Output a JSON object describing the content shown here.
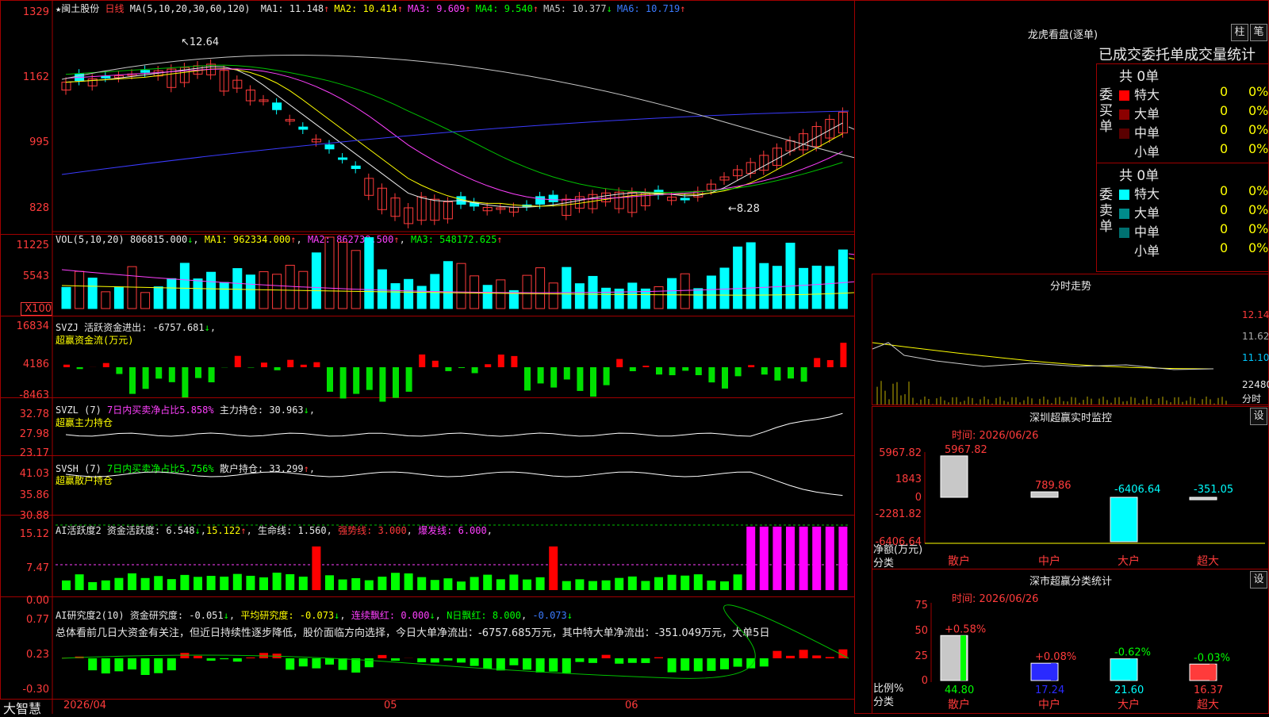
{
  "main_chart": {
    "stock_name": "闽土股份",
    "period": "日线",
    "ma_label": "MA(5,10,20,30,60,120)",
    "ma_values": [
      {
        "name": "MA1:",
        "value": "11.148",
        "arrow": "↑",
        "color": "#e8e8e8"
      },
      {
        "name": "MA2:",
        "value": "10.414",
        "arrow": "↑",
        "color": "#ffff00"
      },
      {
        "name": "MA3:",
        "value": "9.609",
        "arrow": "↑",
        "color": "#ff40ff"
      },
      {
        "name": "MA4:",
        "value": "9.540",
        "arrow": "↑",
        "color": "#00ff00"
      },
      {
        "name": "MA5:",
        "value": "10.377",
        "arrow": "↓",
        "color": "#c8c8c8"
      },
      {
        "name": "MA6:",
        "value": "10.719",
        "arrow": "↑",
        "color": "#3b7bff"
      }
    ],
    "y_ticks": [
      "1329",
      "1162",
      "995",
      "828"
    ],
    "high_label": "12.64",
    "low_label": "8.28"
  },
  "vol_panel": {
    "label": "VOL(5,10,20)",
    "value": "806815.000",
    "ma1": "962334.000",
    "ma2": "862738.500",
    "ma3": "548172.625",
    "y_ticks": [
      "11225",
      "5543",
      "X100"
    ]
  },
  "svzj_panel": {
    "label": "SVZJ  活跃资金进出:",
    "value": "-6757.681",
    "sub": "超赢资金流(万元)",
    "y_ticks": [
      "16834",
      "4186",
      "-8463"
    ]
  },
  "svzl_panel": {
    "label": "SVZL (7)",
    "desc": "7日内买卖净占比5.858%",
    "hold_label": "主力持仓:",
    "hold_value": "30.963",
    "sub": "超赢主力持仓",
    "y_ticks": [
      "32.78",
      "27.98",
      "23.17"
    ]
  },
  "svsh_panel": {
    "label": "SVSH (7)",
    "desc": "7日内买卖净占比5.756%",
    "hold_label": "散户持仓:",
    "hold_value": "33.299",
    "sub": "超赢散户持仓",
    "y_ticks": [
      "41.03",
      "35.86",
      "30.88"
    ]
  },
  "ai_active_panel": {
    "label": "AI活跃度2",
    "active_label": "资金活跃度:",
    "active_value": "6.548",
    "v2": "15.122",
    "life_label": "生命线:",
    "life_value": "1.560",
    "strong_label": "强势线:",
    "strong_value": "3.000",
    "burst_label": "爆发线:",
    "burst_value": "6.000",
    "y_ticks": [
      "15.12",
      "7.47",
      "0.00"
    ]
  },
  "ai_research_panel": {
    "label": "AI研究度2(10)",
    "r_label": "资金研究度:",
    "r_value": "-0.051",
    "avg_label": "平均研究度:",
    "avg_value": "-0.073",
    "cont_label": "连续飘红:",
    "cont_value": "0.000",
    "n_label": "N日飘红:",
    "n_value": "8.000",
    "n_extra": "-0.073",
    "commentary": "总体看前几日大资金有关注，但近日持续性逐步降低，股价面临方向选择，今日大单净流出：-6757.685万元，其中特大单净流出：-351.049万元，大单5日",
    "y_ticks": [
      "0.77",
      "0.23",
      "-0.30"
    ]
  },
  "bottom_axis": {
    "brand": "大智慧",
    "date1": "2026/04",
    "date2": "05",
    "date3": "06"
  },
  "right_panel": {
    "lhb_title": "龙虎看盘(逐单)",
    "btn_zhu": "柱",
    "btn_bi": "笔",
    "stats_title": "已成交委托单成交量统计",
    "buy_label": "委买单",
    "sell_label": "委卖单",
    "buy_total": "共 0单",
    "sell_total": "共 0单",
    "buy_rows": [
      {
        "name": "特大",
        "count": "0",
        "pct": "0%",
        "color": "#ff0000"
      },
      {
        "name": "大单",
        "count": "0",
        "pct": "0%",
        "color": "#8b0000"
      },
      {
        "name": "中单",
        "count": "0",
        "pct": "0%",
        "color": "#5a0000"
      },
      {
        "name": "小单",
        "count": "0",
        "pct": "0%",
        "color": "#000000"
      }
    ],
    "sell_rows": [
      {
        "name": "特大",
        "count": "0",
        "pct": "0%",
        "color": "#00ffff"
      },
      {
        "name": "大单",
        "count": "0",
        "pct": "0%",
        "color": "#008b8b"
      },
      {
        "name": "中单",
        "count": "0",
        "pct": "0%",
        "color": "#007070"
      },
      {
        "name": "小单",
        "count": "0",
        "pct": "0%",
        "color": "#000000"
      }
    ],
    "intraday_title": "分时走势",
    "intraday_ticks": [
      "12.14",
      "11.62",
      "11.10",
      "22480",
      "分时"
    ],
    "monitor_title": "深圳超赢实时监控",
    "monitor_btn": "设",
    "monitor_time": "时间: 2026/06/26",
    "monitor_ticks": [
      "5967.82",
      "1843",
      "0",
      "-2281.82",
      "-6406.64"
    ],
    "monitor_unit": "净额(万元)",
    "monitor_class": "分类",
    "classify_title": "深市超赢分类统计",
    "classify_btn": "设",
    "classify_time": "时间: 2026/06/26",
    "classify_ticks": [
      "75",
      "50",
      "25",
      "0"
    ],
    "classify_unit": "比例%",
    "classify_class": "分类"
  },
  "chart_data": [
    {
      "type": "bar",
      "title": "深圳超赢实时监控",
      "categories": [
        "散户",
        "中户",
        "大户",
        "超大"
      ],
      "values": [
        5967.82,
        789.86,
        -6406.64,
        -351.05
      ],
      "ylabel": "净额(万元)",
      "ylim": [
        -6406.64,
        5967.82
      ]
    },
    {
      "type": "bar",
      "title": "深市超赢分类统计",
      "categories": [
        "散户",
        "中户",
        "大户",
        "超大"
      ],
      "values": [
        44.8,
        17.24,
        21.6,
        16.37
      ],
      "changes": [
        "+0.58%",
        "+0.08%",
        "-0.62%",
        "-0.03%"
      ],
      "ylabel": "比例%",
      "ylim": [
        0,
        75
      ]
    }
  ]
}
